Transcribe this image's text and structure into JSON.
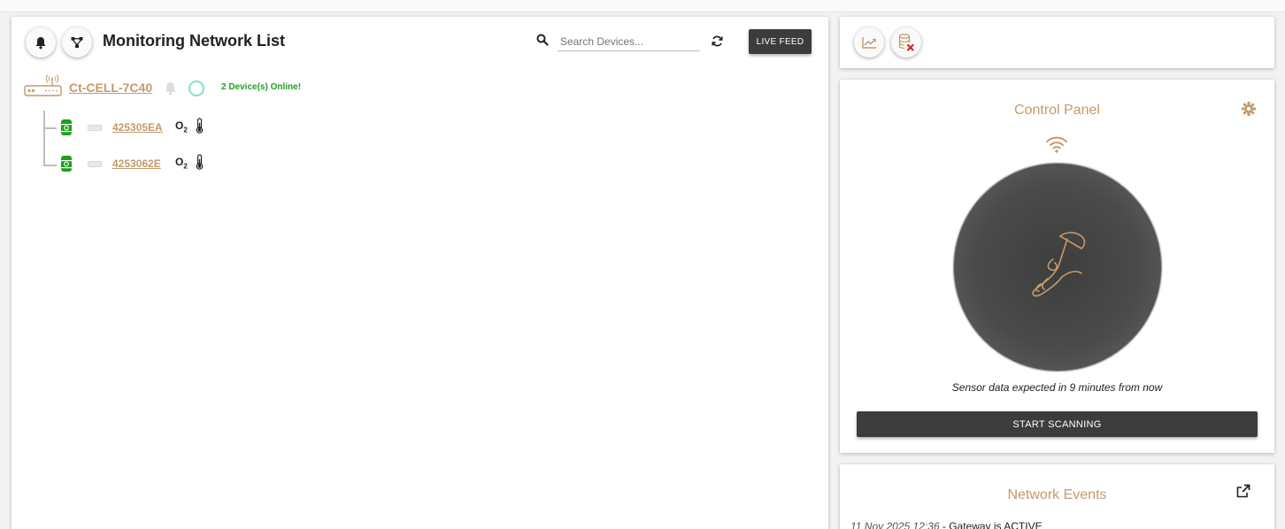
{
  "header": {
    "title": "Monitoring Network List",
    "search": {
      "placeholder": "Search Devices...",
      "value": ""
    },
    "live_feed_label": "LIVE FEED"
  },
  "gateway": {
    "name": "Ct-CELL-7C40",
    "online_text": "2 Device(s) Online!",
    "status_color": "#7fe3c8"
  },
  "devices": [
    {
      "id": "425305EA",
      "sensor_label": "O",
      "sensor_sub": "2",
      "status_color": "#1ea01e"
    },
    {
      "id": "4253062E",
      "sensor_label": "O",
      "sensor_sub": "2",
      "status_color": "#1ea01e"
    }
  ],
  "control_panel": {
    "title": "Control Panel",
    "sensor_message": "Sensor data expected in 9 minutes from now",
    "start_button_label": "START SCANNING"
  },
  "network_events": {
    "title": "Network Events",
    "events": [
      {
        "timestamp": "11 Nov 2025 12:36",
        "separator": " - ",
        "text": "Gateway is ACTIVE"
      }
    ]
  },
  "colors": {
    "accent": "#c49a6c",
    "dark_button": "#3c3c3c",
    "online_green": "#1ea01e"
  },
  "icons": {
    "toolbar_left": [
      "bell-icon",
      "network-icon"
    ],
    "toolbar_right": [
      "chart-icon",
      "database-remove-icon"
    ]
  }
}
